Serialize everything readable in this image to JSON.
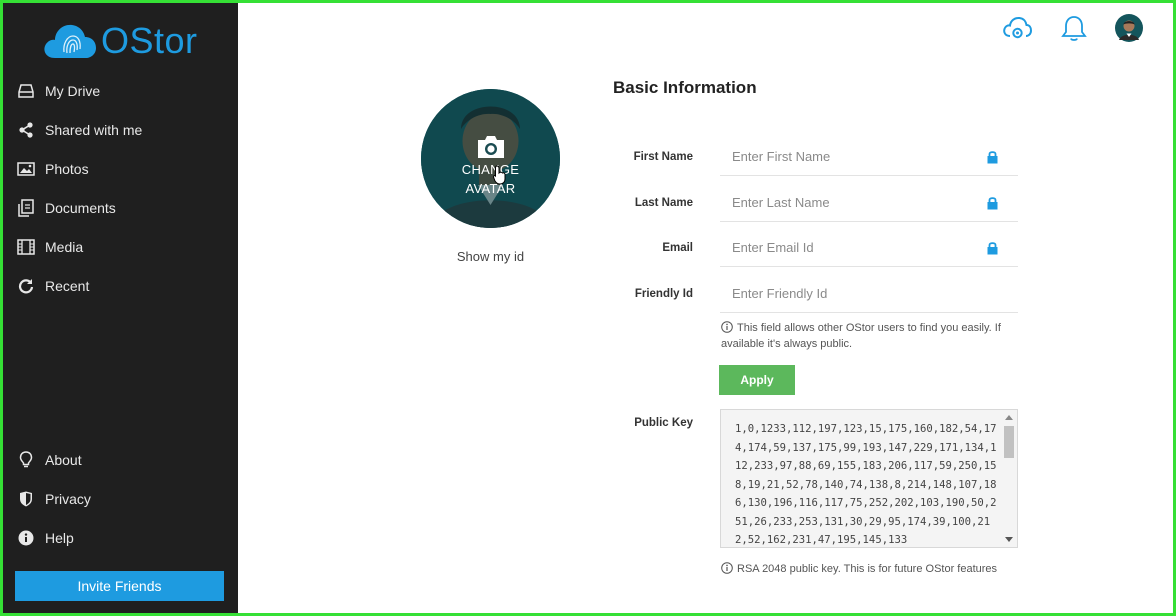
{
  "brand": {
    "name": "OStor",
    "color": "#1e9be0"
  },
  "sidebar": {
    "items": [
      {
        "label": "My Drive",
        "icon": "drive-icon"
      },
      {
        "label": "Shared with me",
        "icon": "share-icon"
      },
      {
        "label": "Photos",
        "icon": "photo-icon"
      },
      {
        "label": "Documents",
        "icon": "documents-icon"
      },
      {
        "label": "Media",
        "icon": "film-icon"
      },
      {
        "label": "Recent",
        "icon": "refresh-icon"
      }
    ],
    "bottom_items": [
      {
        "label": "About",
        "icon": "lightbulb-icon"
      },
      {
        "label": "Privacy",
        "icon": "shield-icon"
      },
      {
        "label": "Help",
        "icon": "info-icon"
      }
    ],
    "invite_label": "Invite Friends"
  },
  "header": {
    "icons": [
      "cloud-settings-icon",
      "bell-icon",
      "user-avatar-icon"
    ]
  },
  "avatar": {
    "change_label_line1": "CHANGE",
    "change_label_line2": "AVATAR",
    "show_id_label": "Show my id"
  },
  "form": {
    "title": "Basic Information",
    "fields": [
      {
        "label": "First Name",
        "placeholder": "Enter First Name",
        "value": "",
        "locked": true
      },
      {
        "label": "Last Name",
        "placeholder": "Enter Last Name",
        "value": "",
        "locked": true
      },
      {
        "label": "Email",
        "placeholder": "Enter Email Id",
        "value": "",
        "locked": true
      },
      {
        "label": "Friendly Id",
        "placeholder": "Enter Friendly Id",
        "value": "",
        "locked": false
      }
    ],
    "friendly_hint": "This field allows other OStor users to find you easily. If available it's always public.",
    "apply_label": "Apply",
    "public_key_label": "Public Key",
    "public_key_value": "1,0,1233,112,197,123,15,175,160,182,54,174,174,59,137,175,99,193,147,229,171,134,112,233,97,88,69,155,183,206,117,59,250,158,19,21,52,78,140,74,138,8,214,148,107,186,130,196,116,117,75,252,202,103,190,50,251,26,233,253,131,30,29,95,174,39,100,212,52,162,231,47,195,145,133",
    "public_key_hint": "RSA 2048 public key. This is for future OStor features"
  },
  "colors": {
    "sidebar_bg": "#1f1f1f",
    "accent": "#1e9be0",
    "apply": "#5cb85c",
    "avatar_bg": "#14555c"
  }
}
